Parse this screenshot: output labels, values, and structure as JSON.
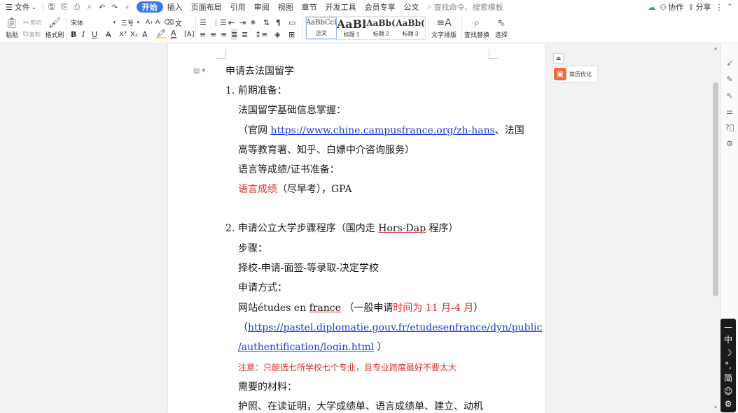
{
  "menubar": {
    "file_menu": "文件",
    "tabs": [
      "开始",
      "插入",
      "页面布局",
      "引用",
      "审阅",
      "视图",
      "章节",
      "开发工具",
      "会员专享",
      "公文"
    ],
    "active_tab": "开始",
    "search_placeholder": "查找命令、搜索模板",
    "collab": "协作",
    "share": "分享"
  },
  "ribbon": {
    "paste": "粘贴",
    "cut": "剪切",
    "copy": "复制",
    "format_painter": "格式刷",
    "font_name": "宋体",
    "font_size": "三号",
    "styles": [
      {
        "sample": "AaBbCcI",
        "caption": "正文"
      },
      {
        "sample": "AaBl",
        "caption": "标题 1"
      },
      {
        "sample": "AaBb(",
        "caption": "标题 2"
      },
      {
        "sample": "AaBb(",
        "caption": "标题 3"
      }
    ],
    "text_layout": "文字排版",
    "find_replace": "查找替换",
    "select": "选择"
  },
  "document": {
    "title": "申请去法国留学",
    "l1": "1.  前期准备：",
    "l2": "法国留学基础信息掌握：",
    "l3_pre": "（官网 ",
    "l3_link": "https://www.chine.campusfrance.org/zh-hans",
    "l3_post": "、法国",
    "l4": "高等教育署、知乎、白嫖中介咨询服务）",
    "l5": "语言等成绩/证书准备：",
    "l6_red": "语言成绩",
    "l6_rest": "（尽早考），GPA",
    "l7_pre": "2.  申请公立大学步骤程序（国内走 ",
    "l7_mid": "Hors-Dap",
    "l7_post": " 程序）",
    "l8": "步骤：",
    "l9": "择校-申请-面签-等录取-决定学校",
    "l10": "申请方式：",
    "l11_pre": "网站études en ",
    "l11_france": "france",
    "l11_mid": "  （一般申请",
    "l11_red": "时间为 11 月-4 月",
    "l11_post": "）",
    "l12_pre": "（",
    "l12_link": "https://pastel.diplomatie.gouv.fr/etudesenfrance/dyn/public",
    "l13_link": "/authentification/login.html",
    "l13_post": " ）",
    "l14_red": "注意：只能选七所学校七个专业，且专业跨度最好不要太大",
    "l15": "需要的材料：",
    "l16": "护照、在读证明，大学成绩单、语言成绩单、建立、动机"
  },
  "right_panel": {
    "resume_optimize": "简历优化"
  },
  "ime": [
    "中",
    "简"
  ]
}
